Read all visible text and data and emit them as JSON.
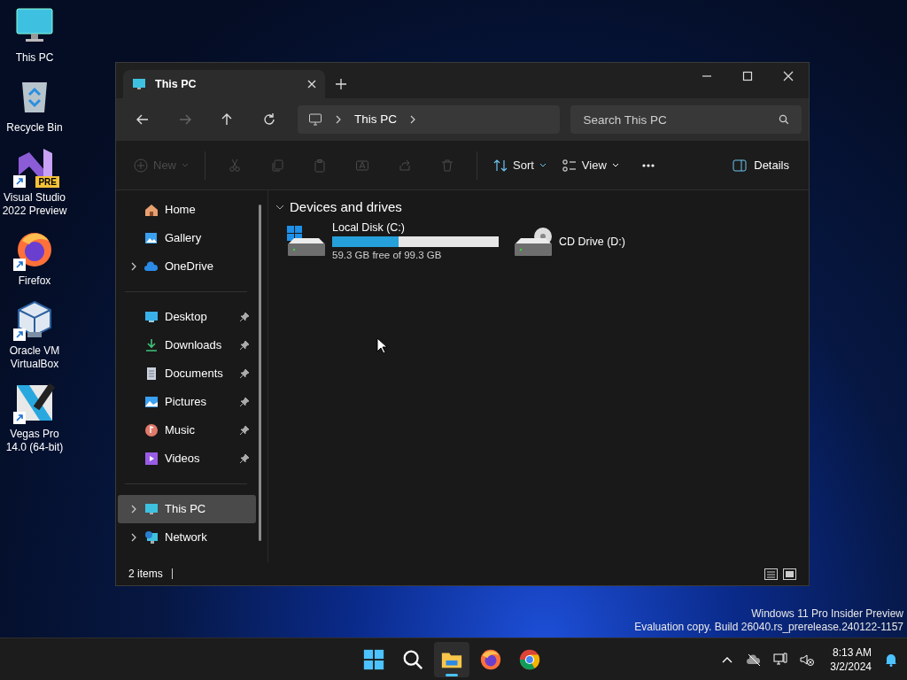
{
  "desktop_icons": [
    {
      "kind": "pc",
      "label": "This PC"
    },
    {
      "kind": "bin",
      "label": "Recycle Bin"
    },
    {
      "kind": "vs",
      "label": "Visual Studio 2022 Preview",
      "badge": "PRE",
      "shortcut": true
    },
    {
      "kind": "firefox",
      "label": "Firefox",
      "shortcut": true
    },
    {
      "kind": "vbox",
      "label": "Oracle VM VirtualBox",
      "shortcut": true
    },
    {
      "kind": "vegas",
      "label": "Vegas Pro 14.0 (64-bit)",
      "shortcut": true
    }
  ],
  "window": {
    "tab": {
      "title": "This PC"
    },
    "address": {
      "segments": [
        "This PC"
      ]
    },
    "search": {
      "placeholder": "Search This PC"
    },
    "toolbar": [
      {
        "kind": "new",
        "label": "New",
        "disabled": true
      },
      {
        "kind": "cut",
        "disabled": true
      },
      {
        "kind": "copy",
        "disabled": true
      },
      {
        "kind": "paste",
        "disabled": true
      },
      {
        "kind": "rename",
        "disabled": true
      },
      {
        "kind": "share",
        "disabled": true
      },
      {
        "kind": "delete",
        "disabled": true
      },
      {
        "kind": "sort",
        "label": "Sort",
        "disabled": false
      },
      {
        "kind": "view",
        "label": "View",
        "disabled": false
      },
      {
        "kind": "more",
        "disabled": false
      }
    ],
    "details_button": "Details",
    "sidebar": [
      [
        {
          "kind": "home",
          "label": "Home",
          "expandable": false,
          "pinned": false,
          "selected": false
        },
        {
          "kind": "gallery",
          "label": "Gallery",
          "expandable": false,
          "pinned": false,
          "selected": false
        },
        {
          "kind": "cloud",
          "label": "OneDrive",
          "expandable": true,
          "pinned": false,
          "selected": false
        }
      ],
      [
        {
          "kind": "desktop",
          "label": "Desktop",
          "expandable": false,
          "pinned": true,
          "selected": false
        },
        {
          "kind": "download",
          "label": "Downloads",
          "expandable": false,
          "pinned": true,
          "selected": false
        },
        {
          "kind": "document",
          "label": "Documents",
          "expandable": false,
          "pinned": true,
          "selected": false
        },
        {
          "kind": "picture",
          "label": "Pictures",
          "expandable": false,
          "pinned": true,
          "selected": false
        },
        {
          "kind": "music",
          "label": "Music",
          "expandable": false,
          "pinned": true,
          "selected": false
        },
        {
          "kind": "video",
          "label": "Videos",
          "expandable": false,
          "pinned": true,
          "selected": false
        }
      ],
      [
        {
          "kind": "pc",
          "label": "This PC",
          "expandable": true,
          "pinned": false,
          "selected": true
        },
        {
          "kind": "network",
          "label": "Network",
          "expandable": true,
          "pinned": false,
          "selected": false
        }
      ]
    ],
    "section": {
      "title": "Devices and drives",
      "expanded": true
    },
    "drives": [
      {
        "kind": "disk",
        "name": "Local Disk (C:)",
        "level": 0.4,
        "caption": "59.3 GB free of 99.3 GB"
      },
      {
        "kind": "cd",
        "name": "CD Drive (D:)"
      }
    ],
    "status_bar": {
      "count": "2 items"
    }
  },
  "evaluation_notice": [
    "Windows 11 Pro Insider Preview",
    "Evaluation copy. Build 26040.rs_prerelease.240122-1157"
  ],
  "taskbar": {
    "apps": [
      {
        "kind": "start",
        "running": false
      },
      {
        "kind": "search",
        "running": false
      },
      {
        "kind": "explorer",
        "running": true
      },
      {
        "kind": "firefox",
        "running": false
      },
      {
        "kind": "chrome",
        "running": false
      }
    ],
    "time": "8:13 AM",
    "date": "3/2/2024"
  }
}
